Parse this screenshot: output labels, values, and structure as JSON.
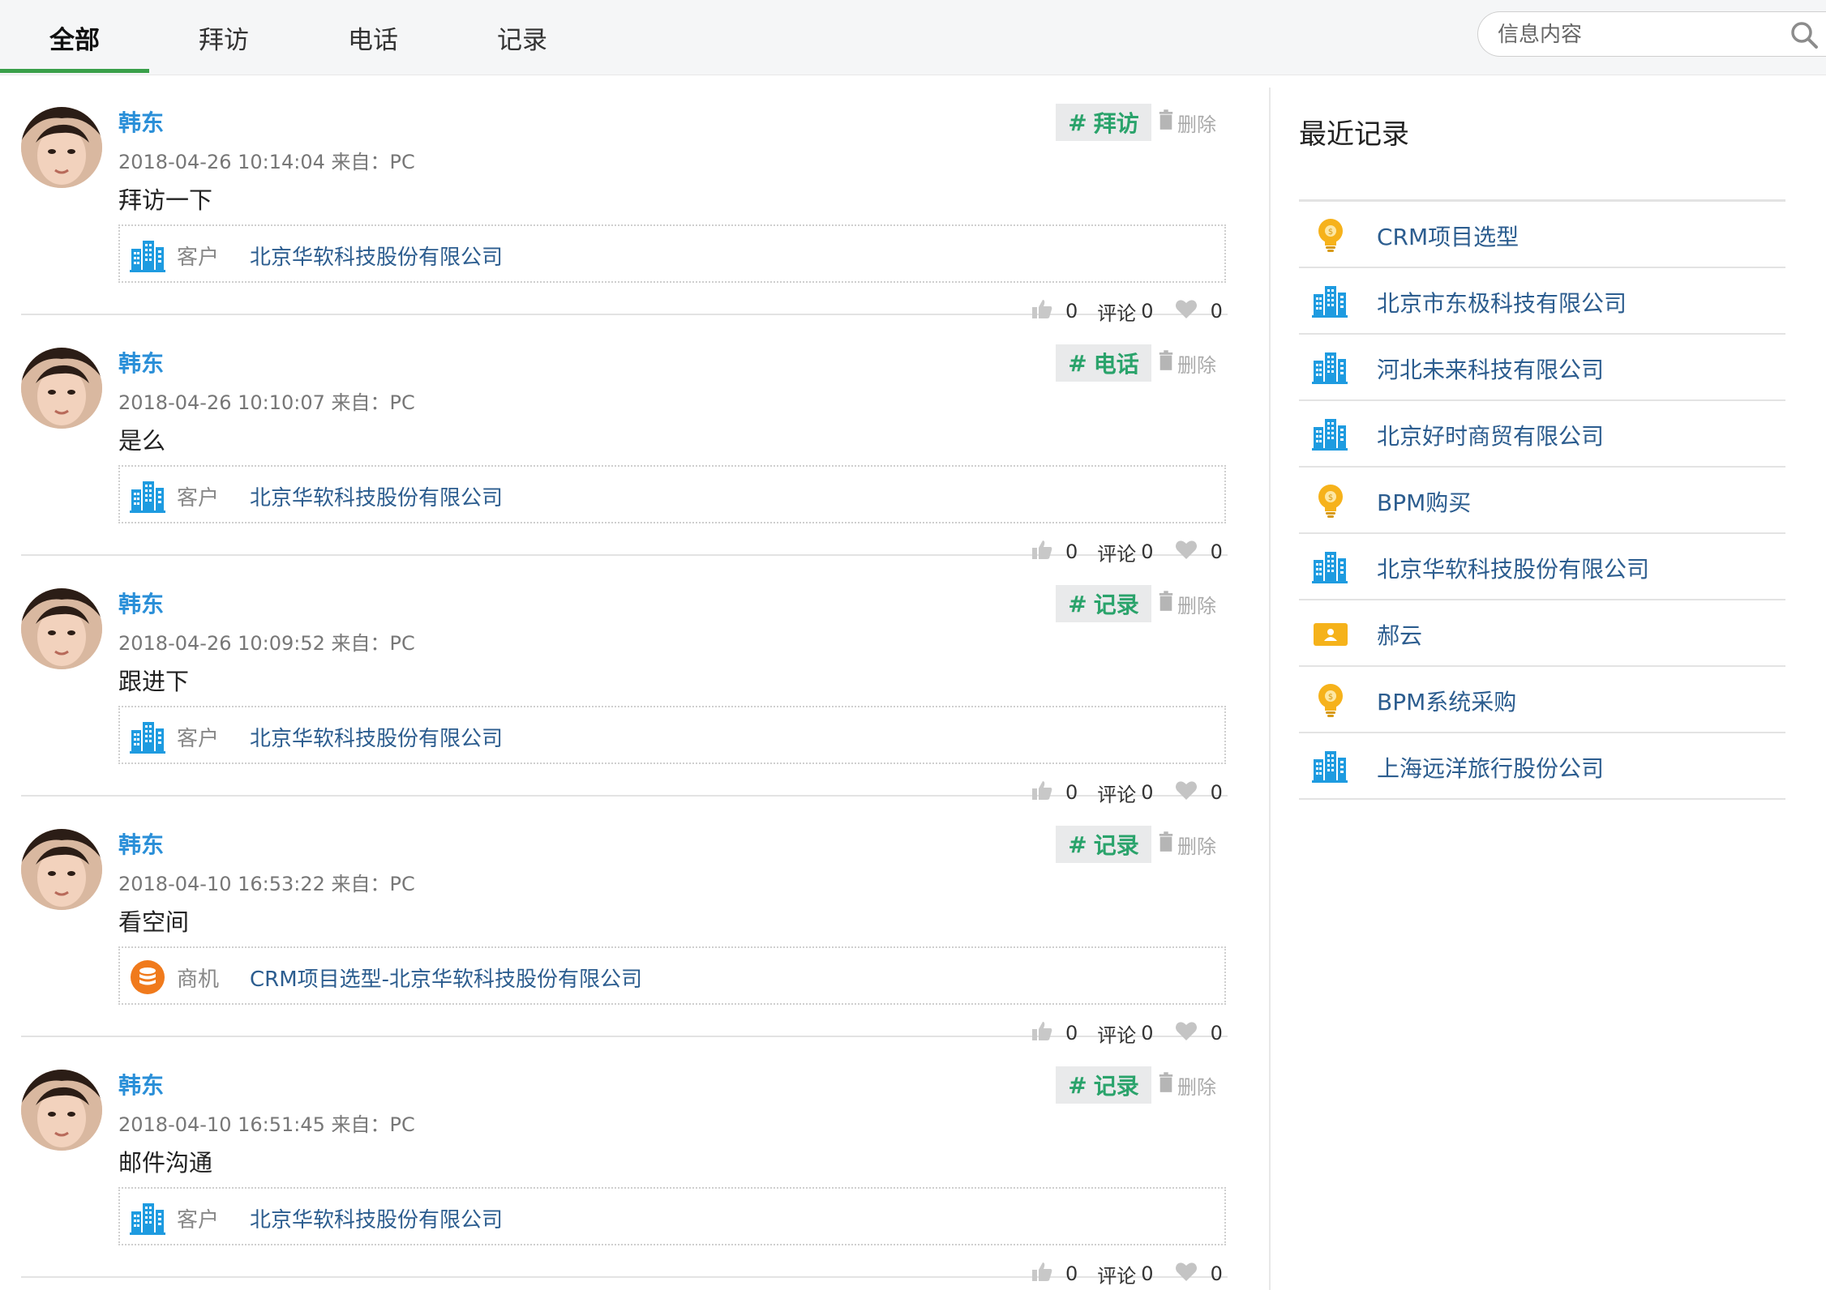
{
  "tabs": [
    {
      "label": "全部",
      "active": true
    },
    {
      "label": "拜访",
      "active": false
    },
    {
      "label": "电话",
      "active": false
    },
    {
      "label": "记录",
      "active": false
    }
  ],
  "search": {
    "placeholder": "信息内容"
  },
  "colors": {
    "accent": "#3aa04a",
    "link": "#2a8fd8",
    "tag": "#2aa36b",
    "entity": "#2c5d8f"
  },
  "feed": [
    {
      "author": "韩东",
      "tag_hash": "#",
      "tag": "拜访",
      "delete": "删除",
      "meta": "2018-04-26 10:14:04 来自：PC",
      "content": "拜访一下",
      "related_type": "客户",
      "related_icon": "building-icon",
      "related_name": "北京华软科技股份有限公司",
      "likes": "0",
      "comment_label": "评论",
      "comments": "0",
      "favorites": "0"
    },
    {
      "author": "韩东",
      "tag_hash": "#",
      "tag": "电话",
      "delete": "删除",
      "meta": "2018-04-26 10:10:07 来自：PC",
      "content": "是么",
      "related_type": "客户",
      "related_icon": "building-icon",
      "related_name": "北京华软科技股份有限公司",
      "likes": "0",
      "comment_label": "评论",
      "comments": "0",
      "favorites": "0"
    },
    {
      "author": "韩东",
      "tag_hash": "#",
      "tag": "记录",
      "delete": "删除",
      "meta": "2018-04-26 10:09:52 来自：PC",
      "content": "跟进下",
      "related_type": "客户",
      "related_icon": "building-icon",
      "related_name": "北京华软科技股份有限公司",
      "likes": "0",
      "comment_label": "评论",
      "comments": "0",
      "favorites": "0"
    },
    {
      "author": "韩东",
      "tag_hash": "#",
      "tag": "记录",
      "delete": "删除",
      "meta": "2018-04-10 16:53:22 来自：PC",
      "content": "看空间",
      "related_type": "商机",
      "related_icon": "coins-icon",
      "related_name": "CRM项目选型-北京华软科技股份有限公司",
      "likes": "0",
      "comment_label": "评论",
      "comments": "0",
      "favorites": "0"
    },
    {
      "author": "韩东",
      "tag_hash": "#",
      "tag": "记录",
      "delete": "删除",
      "meta": "2018-04-10 16:51:45 来自：PC",
      "content": "邮件沟通",
      "related_type": "客户",
      "related_icon": "building-icon",
      "related_name": "北京华软科技股份有限公司",
      "likes": "0",
      "comment_label": "评论",
      "comments": "0",
      "favorites": "0"
    }
  ],
  "sidebar": {
    "title": "最近记录",
    "items": [
      {
        "label": "CRM项目选型",
        "icon": "lightbulb-icon"
      },
      {
        "label": "北京市东极科技有限公司",
        "icon": "building-icon"
      },
      {
        "label": "河北未来科技有限公司",
        "icon": "building-icon"
      },
      {
        "label": "北京好时商贸有限公司",
        "icon": "building-icon"
      },
      {
        "label": "BPM购买",
        "icon": "lightbulb-icon"
      },
      {
        "label": "北京华软科技股份有限公司",
        "icon": "building-icon"
      },
      {
        "label": "郝云",
        "icon": "contact-card-icon"
      },
      {
        "label": "BPM系统采购",
        "icon": "lightbulb-icon"
      },
      {
        "label": "上海远洋旅行股份公司",
        "icon": "building-icon"
      }
    ]
  }
}
